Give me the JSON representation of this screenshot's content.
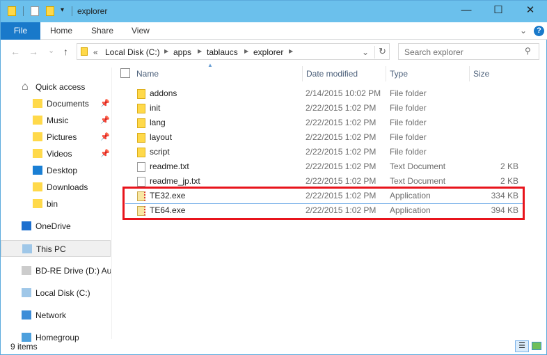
{
  "window": {
    "title": "explorer",
    "minimize": "—",
    "maximize": "☐",
    "close": "✕"
  },
  "ribbon": {
    "tabs": [
      "File",
      "Home",
      "Share",
      "View"
    ],
    "help": "?",
    "expand": "⌄"
  },
  "nav": {
    "back": "←",
    "forward": "→",
    "recent": "⌄",
    "up": "↑"
  },
  "address": {
    "overflow": "«",
    "crumbs": [
      "Local Disk (C:)",
      "apps",
      "tablaucs",
      "explorer"
    ],
    "refresh": "↻",
    "dropdown": "⌄"
  },
  "search": {
    "placeholder": "Search explorer"
  },
  "sidebar": {
    "items": [
      {
        "label": "Quick access",
        "icon": "star-home-icon",
        "pinned": false
      },
      {
        "label": "Documents",
        "icon": "documents-icon",
        "pinned": true
      },
      {
        "label": "Music",
        "icon": "music-icon",
        "pinned": true
      },
      {
        "label": "Pictures",
        "icon": "pictures-icon",
        "pinned": true
      },
      {
        "label": "Videos",
        "icon": "videos-icon",
        "pinned": true
      },
      {
        "label": "Desktop",
        "icon": "desktop-icon",
        "pinned": false
      },
      {
        "label": "Downloads",
        "icon": "downloads-icon",
        "pinned": false
      },
      {
        "label": "bin",
        "icon": "folder-icon",
        "pinned": false
      },
      {
        "label": "OneDrive",
        "icon": "cloud-icon",
        "pinned": false
      },
      {
        "label": "This PC",
        "icon": "computer-icon",
        "pinned": false,
        "selected": true
      },
      {
        "label": "BD-RE Drive (D:) Auc",
        "icon": "disc-drive-icon",
        "pinned": false
      },
      {
        "label": "Local Disk (C:)",
        "icon": "disk-icon",
        "pinned": false
      },
      {
        "label": "Network",
        "icon": "network-icon",
        "pinned": false
      },
      {
        "label": "Homegroup",
        "icon": "homegroup-icon",
        "pinned": false
      }
    ]
  },
  "columns": {
    "name": "Name",
    "date": "Date modified",
    "type": "Type",
    "size": "Size"
  },
  "files": [
    {
      "name": "addons",
      "date": "2/14/2015 10:02 PM",
      "type": "File folder",
      "size": "",
      "kind": "folder"
    },
    {
      "name": "init",
      "date": "2/22/2015 1:02 PM",
      "type": "File folder",
      "size": "",
      "kind": "folder"
    },
    {
      "name": "lang",
      "date": "2/22/2015 1:02 PM",
      "type": "File folder",
      "size": "",
      "kind": "folder"
    },
    {
      "name": "layout",
      "date": "2/22/2015 1:02 PM",
      "type": "File folder",
      "size": "",
      "kind": "folder"
    },
    {
      "name": "script",
      "date": "2/22/2015 1:02 PM",
      "type": "File folder",
      "size": "",
      "kind": "folder"
    },
    {
      "name": "readme.txt",
      "date": "2/22/2015 1:02 PM",
      "type": "Text Document",
      "size": "2 KB",
      "kind": "doc"
    },
    {
      "name": "readme_jp.txt",
      "date": "2/22/2015 1:02 PM",
      "type": "Text Document",
      "size": "2 KB",
      "kind": "doc"
    },
    {
      "name": "TE32.exe",
      "date": "2/22/2015 1:02 PM",
      "type": "Application",
      "size": "334 KB",
      "kind": "app"
    },
    {
      "name": "TE64.exe",
      "date": "2/22/2015 1:02 PM",
      "type": "Application",
      "size": "394 KB",
      "kind": "app"
    }
  ],
  "status": {
    "count": "9 items"
  },
  "colors": {
    "titlebar": "#6bc0ec",
    "file_tab": "#1979ca",
    "highlight": "#e8141c"
  }
}
